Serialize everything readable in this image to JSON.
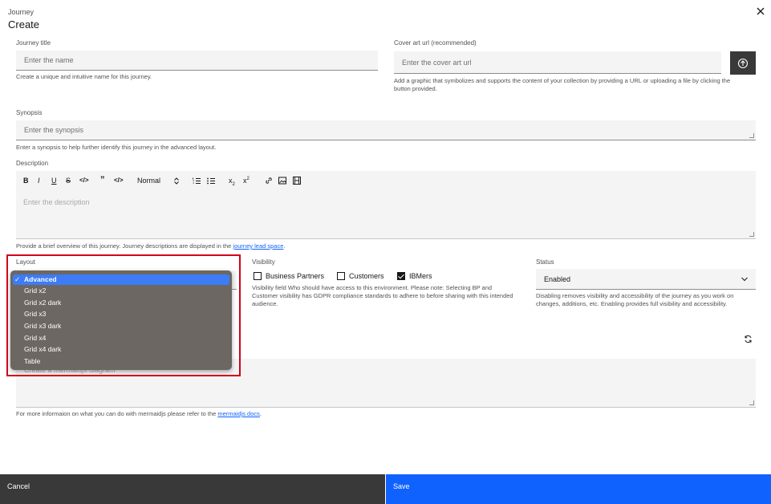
{
  "header": {
    "kicker": "Journey",
    "title": "Create"
  },
  "journey_title": {
    "label": "Journey title",
    "placeholder": "Enter the name",
    "helper": "Create a unique and intuitive name for this journey."
  },
  "cover_art": {
    "label": "Cover art url (recommended)",
    "placeholder": "Enter the cover art url",
    "helper": "Add a graphic that symbolizes and supports the content of your collection by providing a URL or uploading a file by clicking the button provided."
  },
  "synopsis": {
    "label": "Synopsis",
    "placeholder": "Enter the synopsis",
    "helper": "Enter a synopsis to help further identify this journey in the advanced layout."
  },
  "description": {
    "label": "Description",
    "toolbar_format": "Normal",
    "subscript": "x",
    "subscript_mark": "2",
    "superscript": "x",
    "superscript_mark": "2",
    "placeholder": "Enter the description",
    "helper_prefix": "Provide a brief overview of this journey. Journey descriptions are displayed in the ",
    "helper_link": "journey lead space",
    "helper_suffix": "."
  },
  "layout": {
    "label": "Layout",
    "selected": "Advanced",
    "options": [
      "Advanced",
      "Grid x2",
      "Grid x2 dark",
      "Grid x3",
      "Grid x3 dark",
      "Grid x4",
      "Grid x4 dark",
      "Table"
    ],
    "checkmark": "✓"
  },
  "visibility": {
    "label": "Visibility",
    "options": [
      {
        "label": "Business Partners",
        "checked": false
      },
      {
        "label": "Customers",
        "checked": false
      },
      {
        "label": "IBMers",
        "checked": true
      }
    ],
    "helper": "Visibility field Who should have access to this environment. Please note: Selecting BP and Customer visibility has GDPR compliance standards to adhere to before sharing with this intended audience."
  },
  "status": {
    "label": "Status",
    "value": "Enabled",
    "helper": "Disabling removes visibility and accessibility of the journey as you work on changes, additions, etc. Enabling provides full visibility and accessibility."
  },
  "mermaid": {
    "placeholder": "Create a mermaidjs diagram",
    "helper_prefix": "For more informaion on what you can do with mermaidjs please refer to the ",
    "helper_link": "mermaidjs docs",
    "helper_suffix": "."
  },
  "footer": {
    "cancel": "Cancel",
    "save": "Save"
  },
  "colors": {
    "primary": "#0f62fe",
    "dark": "#393939",
    "highlight": "#d0021b",
    "menu": "#6d6763",
    "menu_selected": "#3c7cf6"
  }
}
